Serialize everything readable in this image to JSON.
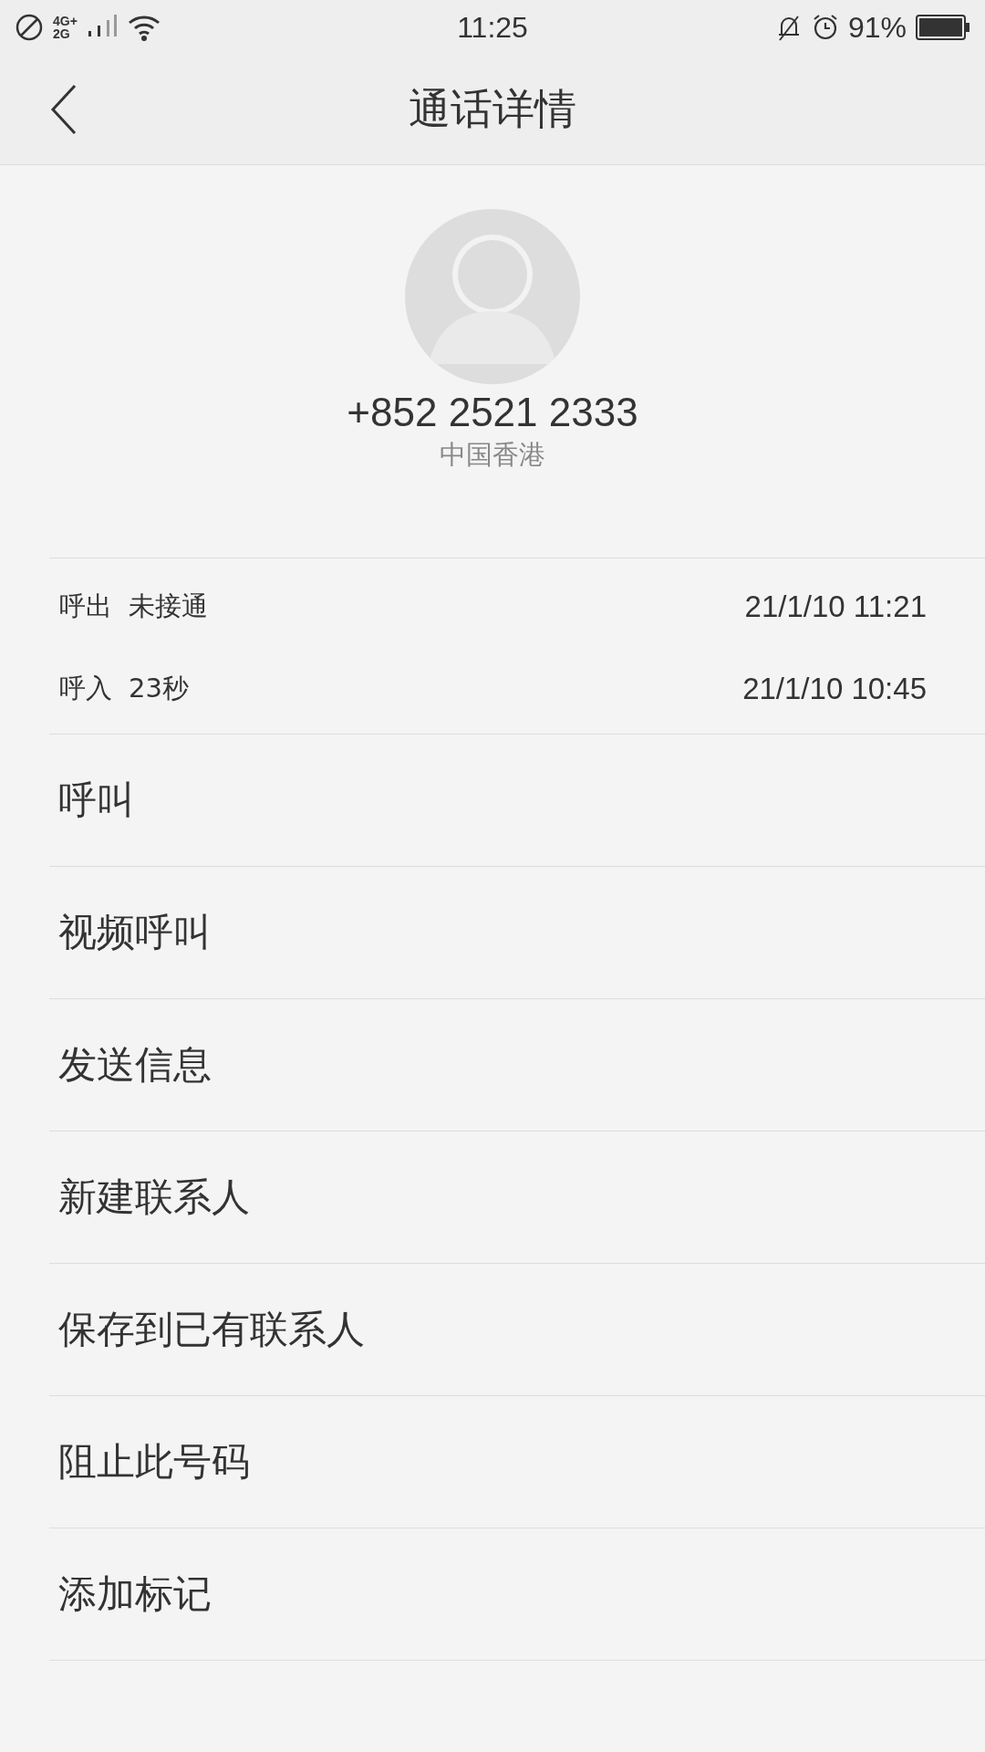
{
  "status_bar": {
    "network_top": "4G+",
    "network_bottom": "2G",
    "time": "11:25",
    "battery": "91%"
  },
  "header": {
    "title": "通话详情"
  },
  "contact": {
    "number": "+852 2521 2333",
    "region": "中国香港"
  },
  "call_log": [
    {
      "direction": "呼出",
      "detail": "未接通",
      "time": "21/1/10 11:21"
    },
    {
      "direction": "呼入",
      "detail": "23秒",
      "time": "21/1/10 10:45"
    }
  ],
  "actions": [
    {
      "label": "呼叫"
    },
    {
      "label": "视频呼叫"
    },
    {
      "label": "发送信息"
    },
    {
      "label": "新建联系人"
    },
    {
      "label": "保存到已有联系人"
    },
    {
      "label": "阻止此号码"
    },
    {
      "label": "添加标记"
    }
  ]
}
